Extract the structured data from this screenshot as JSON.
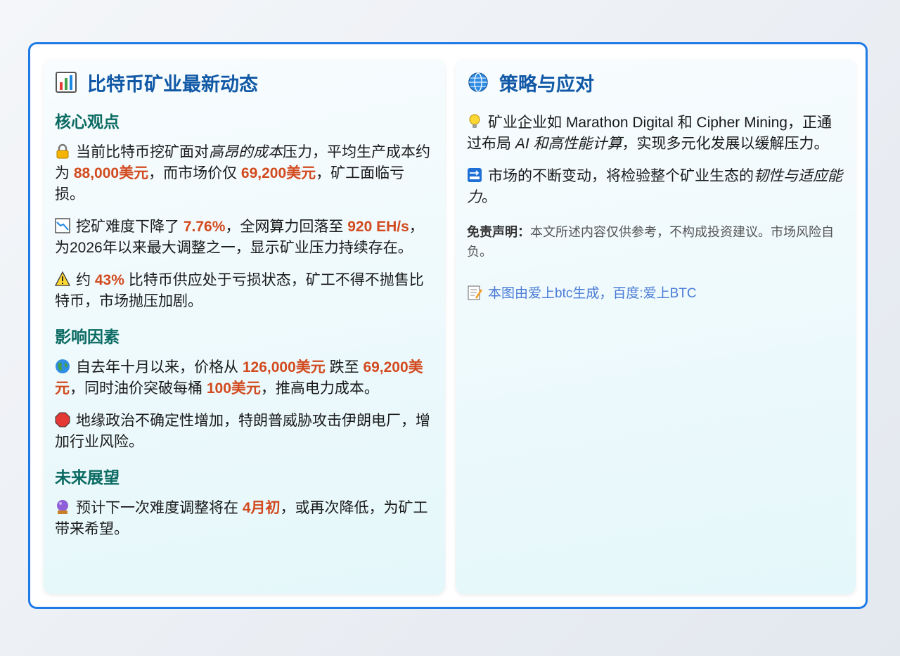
{
  "left": {
    "title": "比特币矿业最新动态",
    "title_icon": "bar-chart-icon",
    "sections": [
      {
        "title": "核心观点",
        "items": [
          {
            "icon": "lock-icon",
            "parts": [
              "当前比特币挖矿面对",
              "高昂的成本",
              "压力，平均生产成本约为 ",
              "88,000美元",
              "，而市场价仅 ",
              "69,200美元",
              "，矿工面临亏损。"
            ]
          },
          {
            "icon": "chart-decreasing-icon",
            "parts": [
              "挖矿难度下降了 ",
              "7.76%",
              "，全网算力回落至 ",
              "920 EH/s",
              "，为2026年以来最大调整之一，显示矿业压力持续存在。"
            ]
          },
          {
            "icon": "warning-icon",
            "parts": [
              "约 ",
              "43%",
              " 比特币供应处于亏损状态，矿工不得不抛售比特币，市场抛压加剧。"
            ]
          }
        ]
      },
      {
        "title": "影响因素",
        "items": [
          {
            "icon": "globe-icon",
            "parts": [
              "自去年十月以来，价格从 ",
              "126,000美元",
              " 跌至 ",
              "69,200美元",
              "，同时油价突破每桶 ",
              "100美元",
              "，推高电力成本。"
            ]
          },
          {
            "icon": "stop-sign-icon",
            "parts": [
              "地缘政治不确定性增加，特朗普威胁攻击伊朗电厂，增加行业风险。"
            ]
          }
        ]
      },
      {
        "title": "未来展望",
        "items": [
          {
            "icon": "crystal-ball-icon",
            "parts": [
              "预计下一次难度调整将在 ",
              "4月初",
              "，或再次降低，为矿工带来希望。"
            ]
          }
        ]
      }
    ]
  },
  "right": {
    "title": "策略与应对",
    "title_icon": "globe-meridians-icon",
    "items": [
      {
        "icon": "lightbulb-icon",
        "parts": [
          "矿业企业如 Marathon Digital 和 Cipher Mining，正通过布局 ",
          "AI 和高性能计算",
          "，实现多元化发展以缓解压力。"
        ]
      },
      {
        "icon": "soon-arrow-icon",
        "parts": [
          "市场的不断变动，将检验整个矿业生态的",
          "韧性与适应能力",
          "。"
        ]
      }
    ],
    "disclaimer_label": "免责声明：",
    "disclaimer_text": "本文所述内容仅供参考，不构成投资建议。市场风险自负。",
    "credit_icon": "memo-icon",
    "credit_text": "本图由爱上btc生成，百度:爱上BTC"
  },
  "colors": {
    "frame_border": "#1e7be6",
    "title": "#1159a6",
    "section_title": "#0b6b63",
    "emphasis": "#d24a1e",
    "link": "#4a7bd6"
  }
}
